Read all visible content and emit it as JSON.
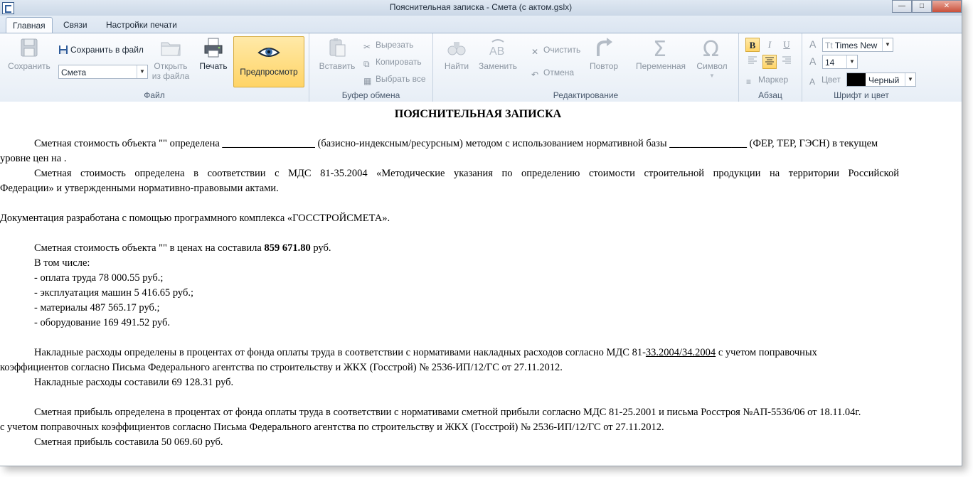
{
  "window": {
    "title": "Пояснительная записка - Смета (с актом.gslx)"
  },
  "tabs": [
    "Главная",
    "Связи",
    "Настройки печати"
  ],
  "ribbon": {
    "file": {
      "label": "Файл",
      "save": "Сохранить",
      "save_to_file": "Сохранить в файл",
      "combo_value": "Смета",
      "open_line1": "Открыть",
      "open_line2": "из файла",
      "print": "Печать",
      "preview": "Предпросмотр"
    },
    "clipboard": {
      "label": "Буфер обмена",
      "paste": "Вставить",
      "cut": "Вырезать",
      "copy": "Копировать",
      "select_all": "Выбрать все"
    },
    "editing": {
      "label": "Редактирование",
      "find": "Найти",
      "replace": "Заменить",
      "clear": "Очистить",
      "undo": "Отмена",
      "redo": "Повтор",
      "variable": "Переменная",
      "symbol": "Символ"
    },
    "paragraph": {
      "label": "Абзац",
      "bold": "B",
      "italic": "I",
      "underline": "U",
      "marker": "Маркер"
    },
    "font": {
      "label": "Шрифт и цвет",
      "font_name": "Times New",
      "font_size": "14",
      "color_label": "Цвет",
      "color_name": "Черный",
      "color_value": "#000000"
    }
  },
  "document": {
    "heading": "ПОЯСНИТЕЛЬНАЯ ЗАПИСКА",
    "p1_a": "Сметная стоимость объекта \"\" определена ",
    "p1_blank1": "__________________",
    "p1_b": " (базисно-индексным/ресурсным) методом с использованием нормативной базы ",
    "p1_blank2": "_______________",
    "p1_c": " (ФЕР, ТЕР, ГЭСН) в текущем",
    "p1_d": "уровне цен на .",
    "p2_a": "Сметная стоимость определена в соответствии с МДС 81-35.2004 «Методические указания по определению стоимости строительной продукции на территории Российской",
    "p2_b": "Федерации» и утвержденными нормативно-правовыми актами.",
    "p3": "Документация разработана с помощью программного комплекса «ГОССТРОЙСМЕТА».",
    "p4_a": "Сметная стоимость объекта \"\" в ценах на  составила ",
    "p4_total": "859 671.80",
    "p4_b": " руб.",
    "incl": "В том числе:",
    "items": [
      "- оплата труда 78 000.55 руб.;",
      "- эксплуатация машин 5 416.65 руб.;",
      "- материалы 487 565.17 руб.;",
      "- оборудование 169 491.52 руб."
    ],
    "p5_a": "Накладные расходы определены в процентах от фонда оплаты труда в соответствии с нормативами накладных расходов согласно МДС 81-",
    "p5_link": "33.2004/34.2004",
    "p5_b": " с учетом поправочных",
    "p5_c": "коэффициентов согласно Письма Федерального агентства по строительству и ЖКХ (Госстрой) № 2536-ИП/12/ГС от 27.11.2012.",
    "p5_d": "Накладные расходы составили 69 128.31 руб.",
    "p6_a": "Сметная прибыль определена в процентах от фонда оплаты труда в соответствии с нормативами сметной прибыли согласно МДС 81-25.2001 и письма Росстроя №АП-5536/06 от 18.11.04г.",
    "p6_b": "с учетом поправочных коэффициентов согласно Письма Федерального агентства по строительству и ЖКХ (Госстрой) № 2536-ИП/12/ГС от 27.11.2012.",
    "p6_c": "Сметная прибыль составила 50 069.60 руб."
  }
}
